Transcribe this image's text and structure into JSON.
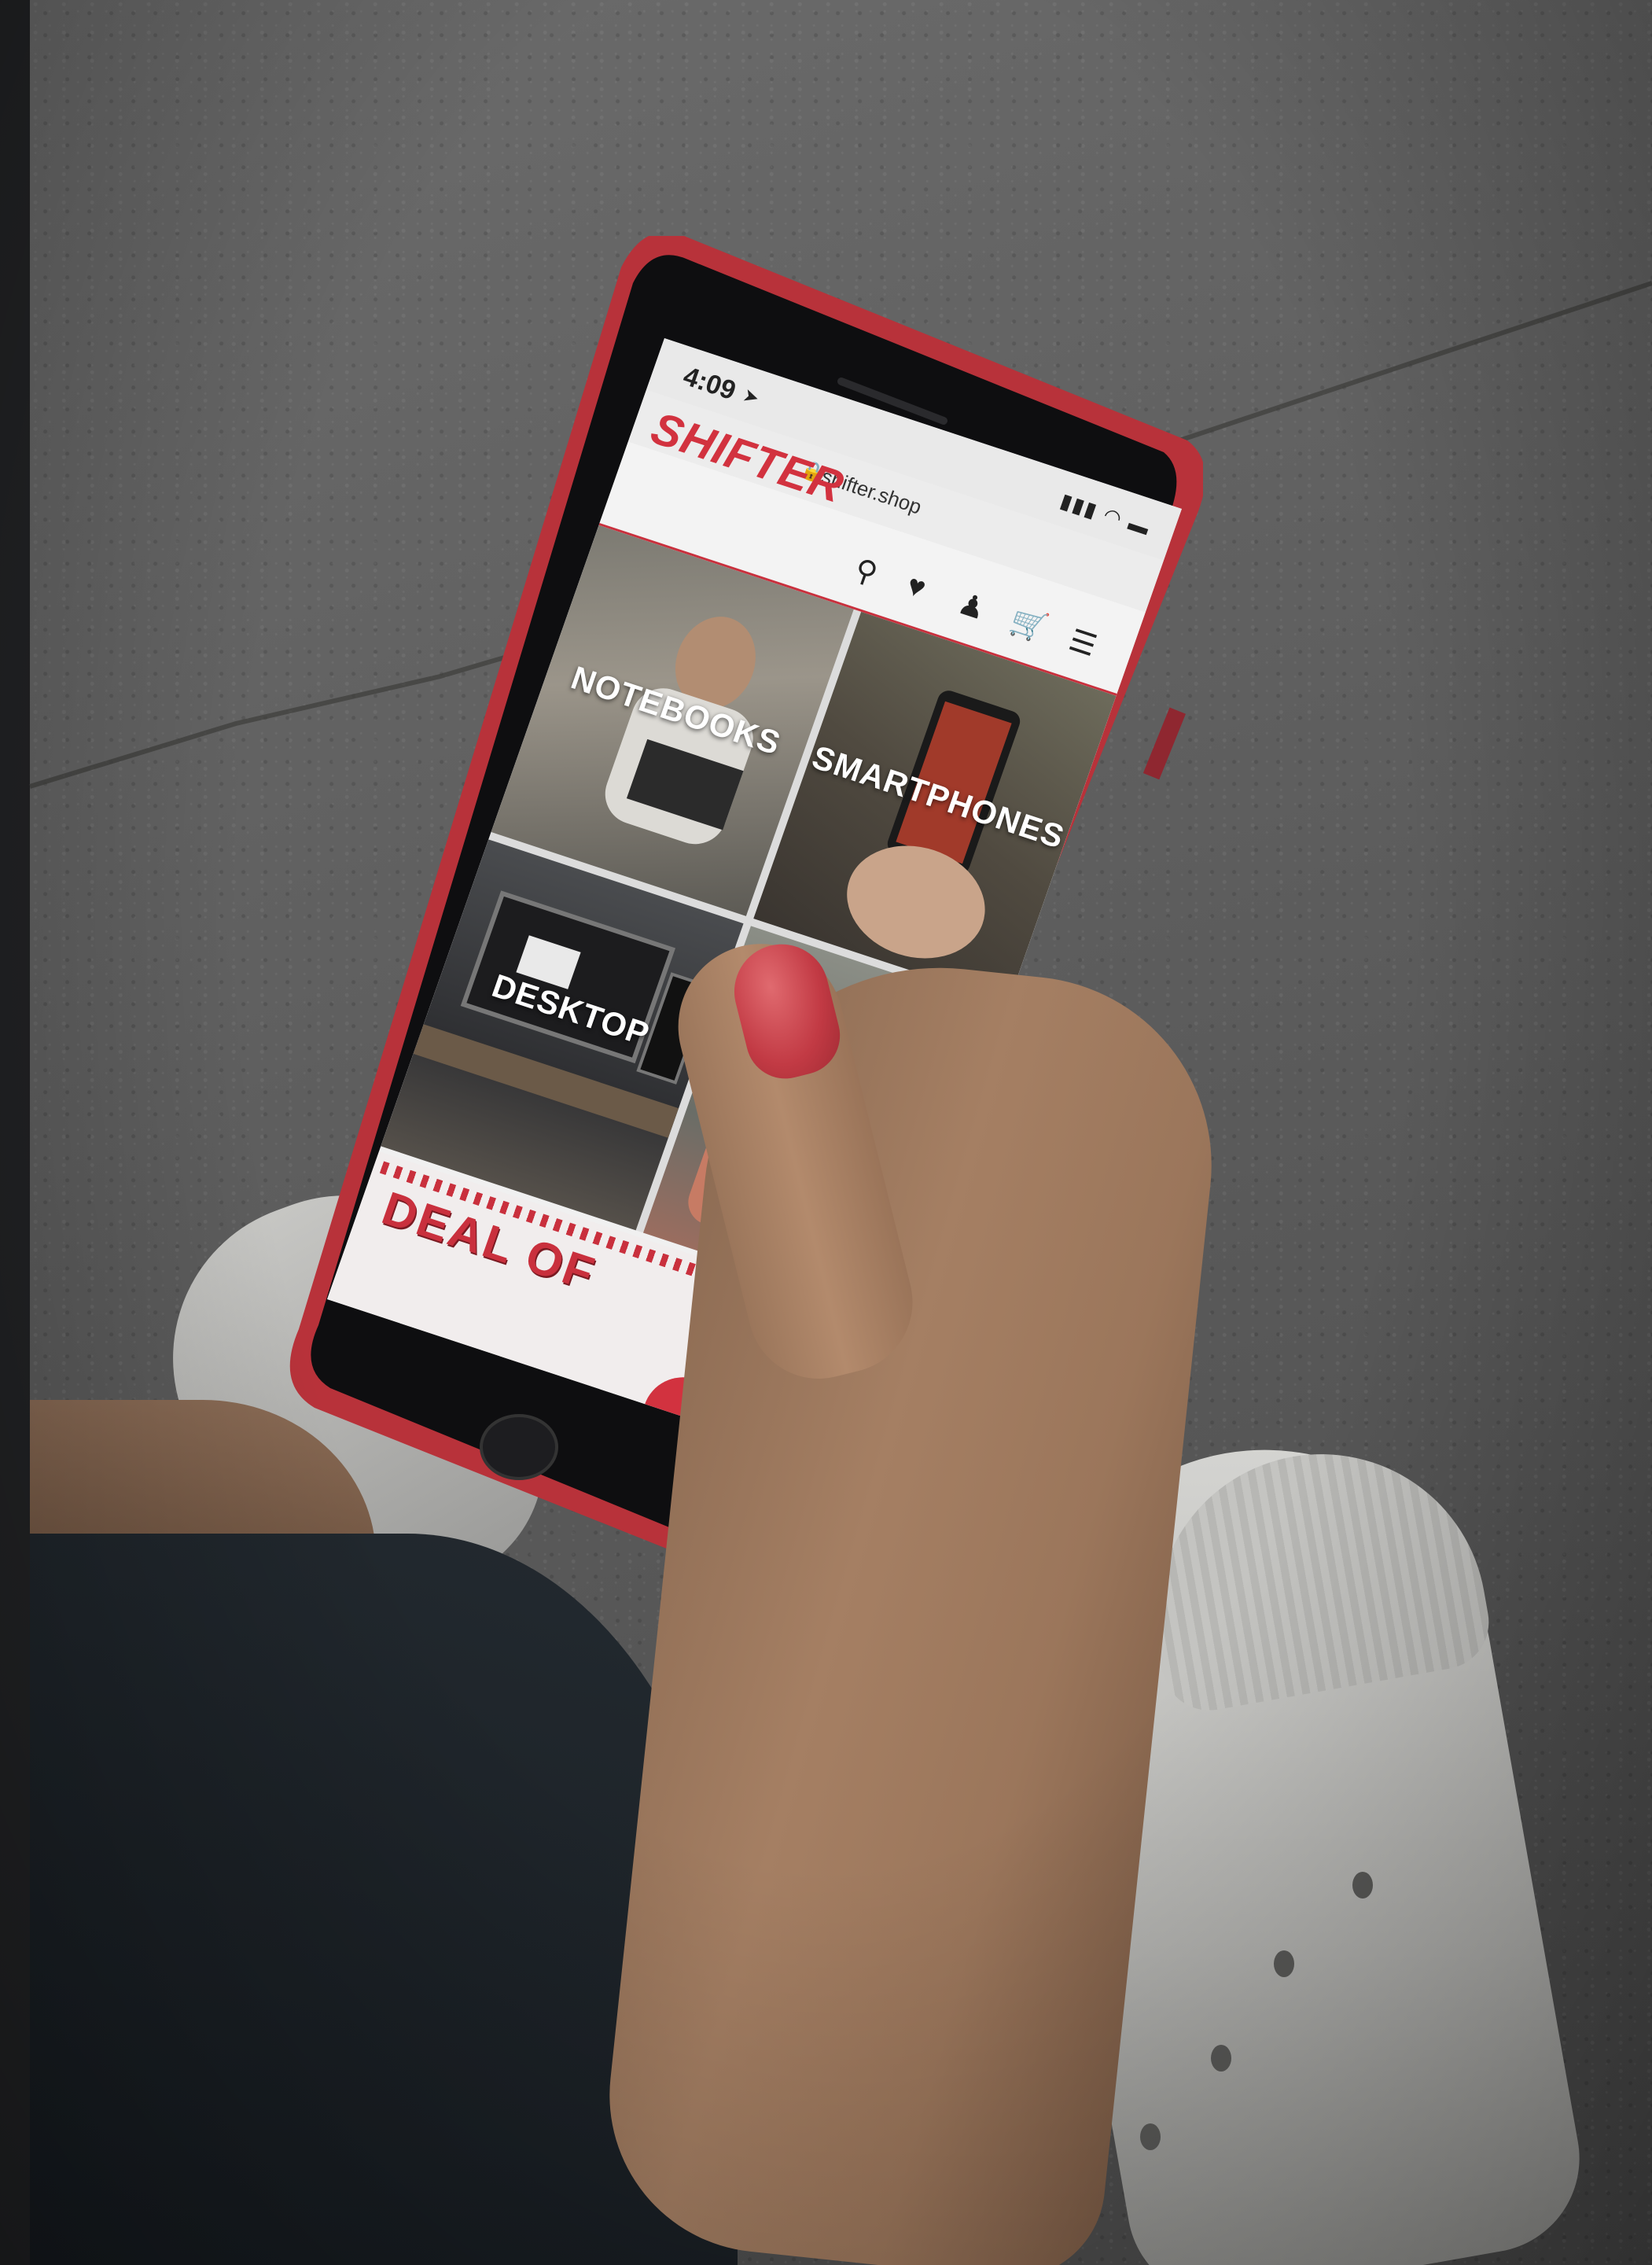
{
  "status_bar": {
    "time": "4:09",
    "location_icon": "location-arrow-icon",
    "signal_text": "▮▮▮ ◠ ▬"
  },
  "browser": {
    "url": "shifter.shop",
    "lock_icon": "lock-icon"
  },
  "site": {
    "brand": "SHIFTER",
    "brand_color": "#d2323f",
    "header_icons": [
      "search-icon",
      "heart-icon",
      "user-icon",
      "cart-icon",
      "menu-icon"
    ]
  },
  "categories": [
    {
      "label": "NOTEBOOKS"
    },
    {
      "label": "SMARTPHONES"
    },
    {
      "label": "DESKTOP"
    },
    {
      "label": ""
    }
  ],
  "promo": {
    "title": "DEAL OF"
  }
}
